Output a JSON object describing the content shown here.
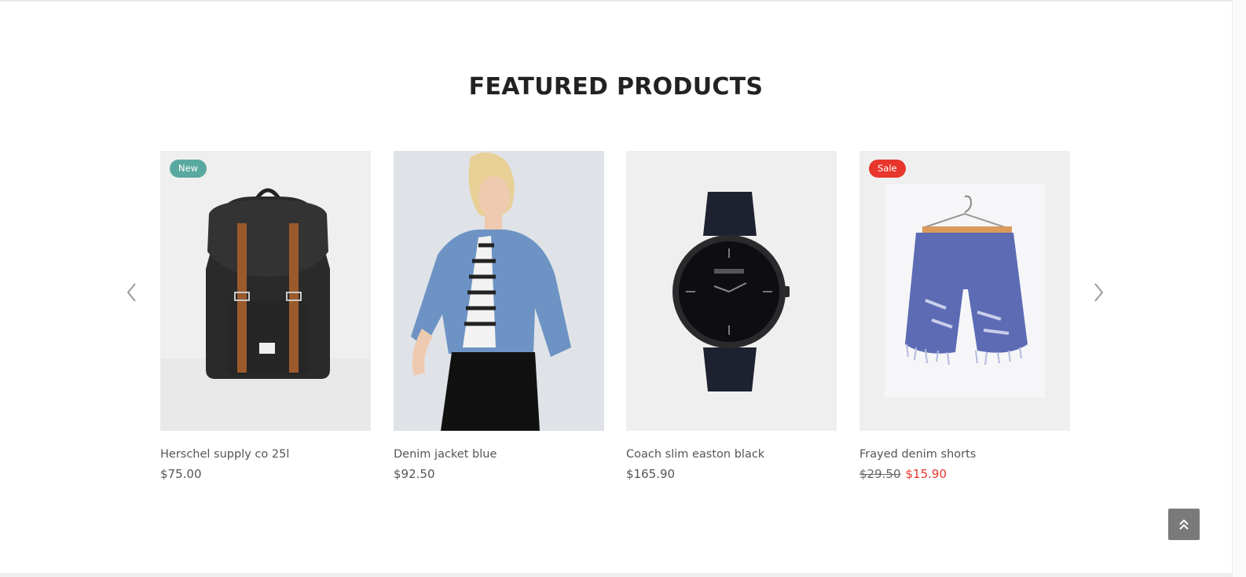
{
  "section": {
    "title": "FEATURED PRODUCTS"
  },
  "carousel": {
    "prev_icon": "chevron-left-icon",
    "next_icon": "chevron-right-icon"
  },
  "products": [
    {
      "name": "Herschel supply co 25l",
      "price": "$75.00",
      "badge": "New",
      "image": "backpack-image"
    },
    {
      "name": "Denim jacket blue",
      "price": "$92.50",
      "image": "denim-jacket-model-image"
    },
    {
      "name": "Coach slim easton black",
      "price": "$165.90",
      "image": "watch-image"
    },
    {
      "name": "Frayed denim shorts",
      "old_price": "$29.50",
      "sale_price": "$15.90",
      "badge": "Sale",
      "image": "denim-shorts-image"
    }
  ],
  "back_to_top": {
    "icon": "double-chevron-up-icon"
  },
  "colors": {
    "badge_new": "#5aa9a0",
    "badge_sale": "#e8362c",
    "sale_price": "#e8362c",
    "back_to_top_bg": "#7a7a7a"
  }
}
